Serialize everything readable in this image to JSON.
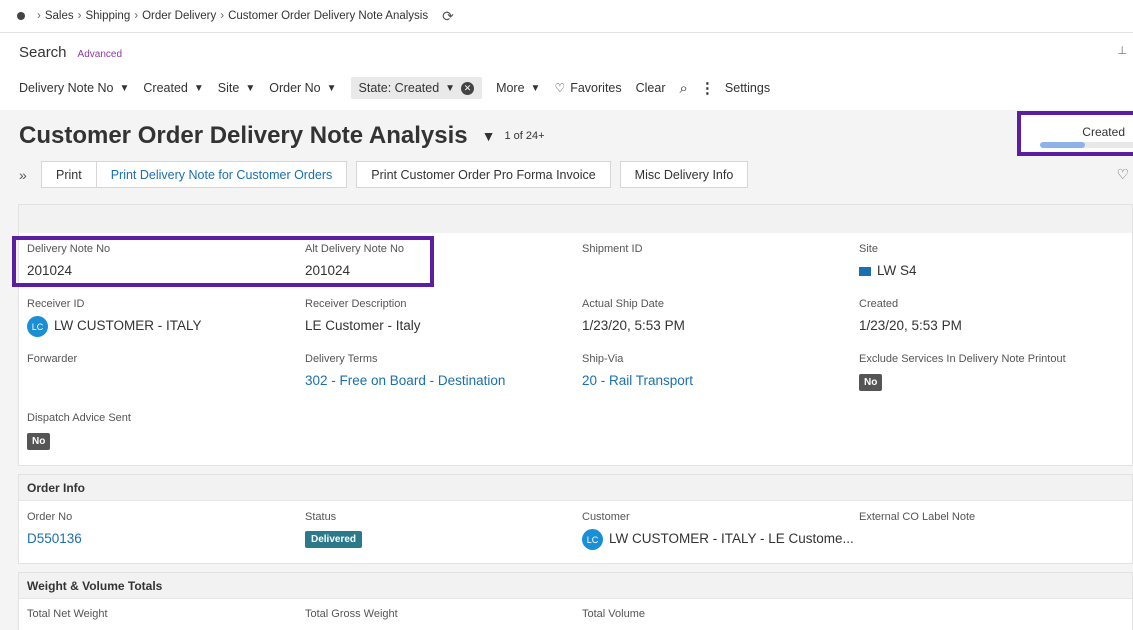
{
  "breadcrumb": {
    "items": [
      "Sales",
      "Shipping",
      "Order Delivery",
      "Customer Order Delivery Note Analysis"
    ]
  },
  "search": {
    "title": "Search",
    "advanced_label": "Advanced"
  },
  "filters": {
    "delivery_note_no": "Delivery Note No",
    "created": "Created",
    "site": "Site",
    "order_no": "Order No",
    "state_chip": "State: Created",
    "more": "More",
    "favorites": "Favorites",
    "clear": "Clear",
    "settings": "Settings"
  },
  "page": {
    "title": "Customer Order Delivery Note Analysis",
    "record_count": "1 of 24+"
  },
  "state_indicator": {
    "label": "Created",
    "progress": 0.45
  },
  "toolbar": {
    "print": "Print",
    "print_delivery_note": "Print Delivery Note for Customer Orders",
    "print_pro_forma": "Print Customer Order Pro Forma Invoice",
    "misc_delivery_info": "Misc Delivery Info"
  },
  "details": {
    "delivery_note_no": {
      "label": "Delivery Note No",
      "value": "201024"
    },
    "alt_delivery_note_no": {
      "label": "Alt Delivery Note No",
      "value": "201024"
    },
    "shipment_id": {
      "label": "Shipment ID",
      "value": ""
    },
    "site": {
      "label": "Site",
      "value": "LW S4"
    },
    "receiver_id": {
      "label": "Receiver ID",
      "value": "LW CUSTOMER - ITALY",
      "avatar": "LC"
    },
    "receiver_description": {
      "label": "Receiver Description",
      "value": "LE Customer - Italy"
    },
    "actual_ship_date": {
      "label": "Actual Ship Date",
      "value": "1/23/20, 5:53 PM"
    },
    "created": {
      "label": "Created",
      "value": "1/23/20, 5:53 PM"
    },
    "forwarder": {
      "label": "Forwarder",
      "value": ""
    },
    "delivery_terms": {
      "label": "Delivery Terms",
      "value": "302 - Free on Board - Destination"
    },
    "ship_via": {
      "label": "Ship-Via",
      "value": "20 - Rail Transport"
    },
    "exclude_services": {
      "label": "Exclude Services In Delivery Note Printout",
      "value": "No"
    },
    "dispatch_advice_sent": {
      "label": "Dispatch Advice Sent",
      "value": "No"
    }
  },
  "order_info": {
    "header": "Order Info",
    "order_no": {
      "label": "Order No",
      "value": "D550136"
    },
    "status": {
      "label": "Status",
      "value": "Delivered"
    },
    "customer": {
      "label": "Customer",
      "value": "LW CUSTOMER - ITALY - LE Custome...",
      "avatar": "LC"
    },
    "external_co_label_note": {
      "label": "External CO Label Note",
      "value": ""
    }
  },
  "weight_volume": {
    "header": "Weight & Volume Totals",
    "total_net_weight": {
      "label": "Total Net Weight"
    },
    "total_gross_weight": {
      "label": "Total Gross Weight"
    },
    "total_volume": {
      "label": "Total Volume"
    }
  },
  "colors": {
    "accent_purple": "#5b1ea0",
    "link_blue": "#1a6fb0",
    "avatar_blue": "#1a8fd6",
    "delivered_teal": "#2a7a8c",
    "progress_blue": "#8fb3e8"
  }
}
